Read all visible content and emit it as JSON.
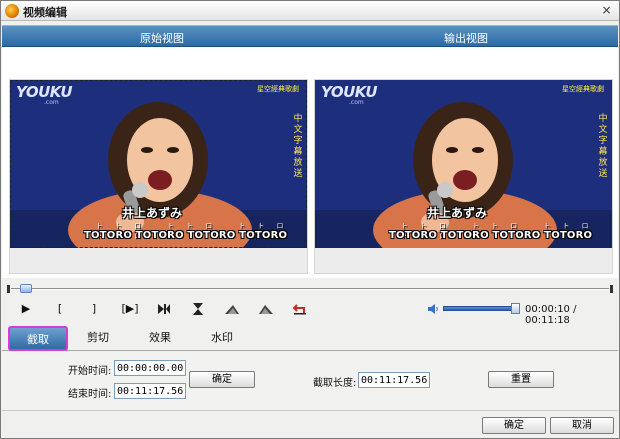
{
  "window": {
    "title": "视频编辑",
    "close": "×"
  },
  "header": {
    "source_label": "原始视图",
    "output_label": "输出视图"
  },
  "video": {
    "watermark": "YOUKU",
    "watermark_sub": ".com",
    "corner_caption": "星空經典歌劇",
    "side_caption": "中文字幕放送",
    "name_caption": "井上あずみ",
    "lyric_small": "トトロ トトロ トトロ トトロ",
    "lyric_caption": "TOTORO TOTORO TOTORO TOTORO"
  },
  "controls": {
    "play": "▶",
    "mark_in": "[",
    "mark_out": "]",
    "play_selection": "[▶]",
    "next_frame": "▶|",
    "icons": [
      "play-icon",
      "mark-in-icon",
      "mark-out-icon",
      "play-selection-icon",
      "step-icon",
      "trim-icon",
      "fade-in-icon",
      "fade-out-icon",
      "undo-icon",
      "volume-icon"
    ],
    "time_display": "00:00:10 / 00:11:18",
    "seek_progress": 0.015,
    "volume_level": 0.95
  },
  "tabs": [
    {
      "label": "截取",
      "active": true
    },
    {
      "label": "剪切",
      "active": false
    },
    {
      "label": "效果",
      "active": false
    },
    {
      "label": "水印",
      "active": false
    }
  ],
  "trim_panel": {
    "start_label": "开始时间:",
    "start_value": "00:00:00.000",
    "end_label": "结束时间:",
    "end_value": "00:11:17.564",
    "confirm_label": "确定",
    "length_label": "截取长度:",
    "length_value": "00:11:17.564",
    "reset_label": "重置"
  },
  "footer": {
    "ok_label": "确定",
    "cancel_label": "取消"
  },
  "colors": {
    "header_blue": "#2b6aa6",
    "tab_highlight": "#d43cd8",
    "video_bg": "#1b2f79"
  }
}
